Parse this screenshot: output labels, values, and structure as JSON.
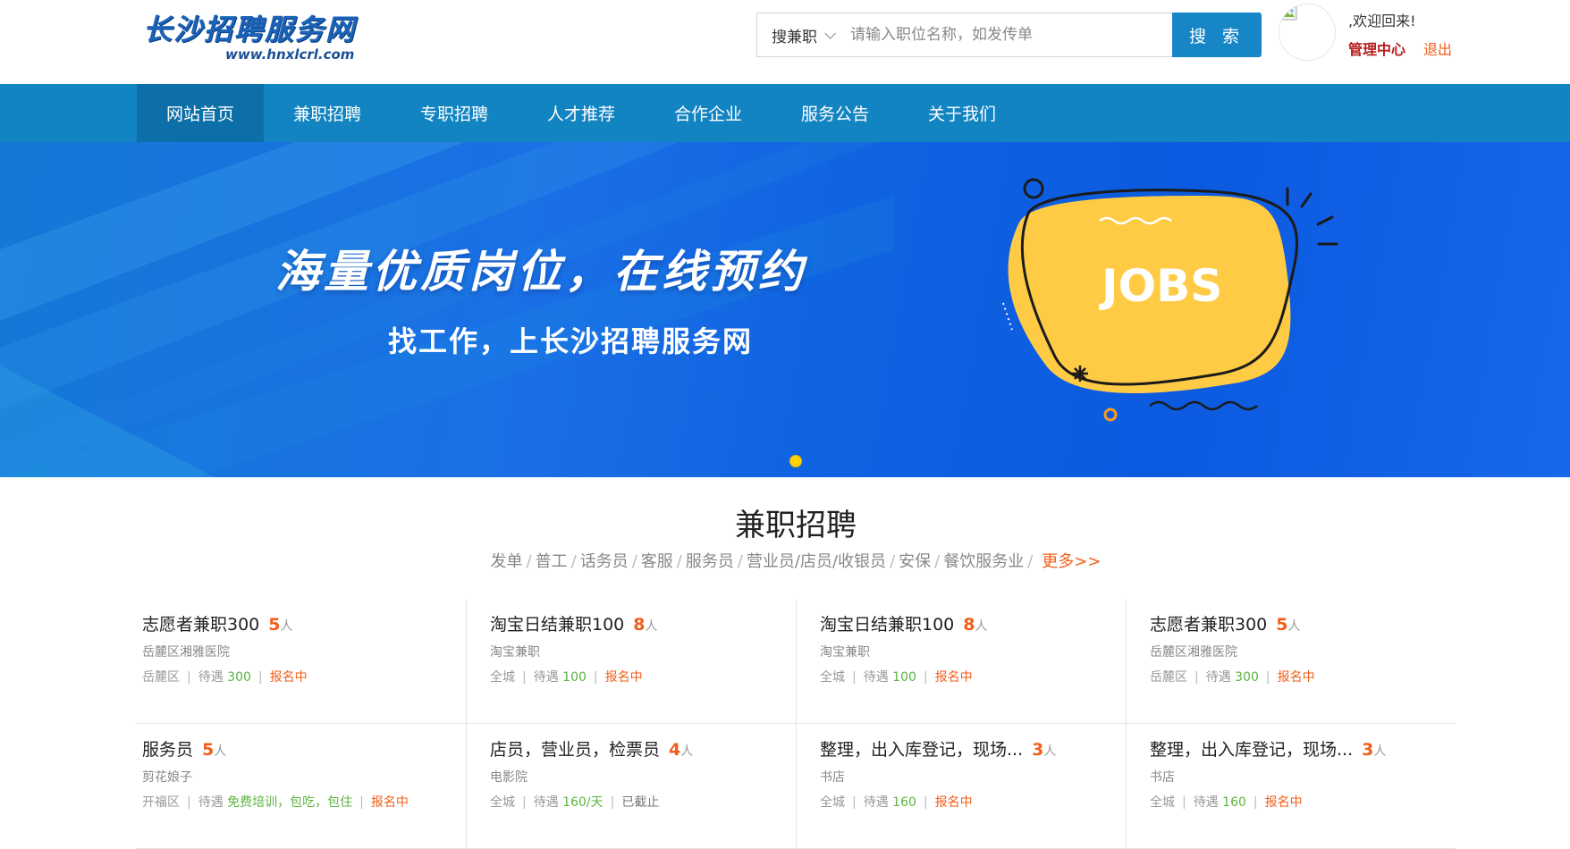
{
  "header": {
    "logo_main": "长沙招聘服务网",
    "logo_sub": "www.hnxlcrl.com",
    "search_type": "搜兼职",
    "search_placeholder": "请输入职位名称，如发传单",
    "search_button": "搜 索",
    "welcome": ",欢迎回来!",
    "admin_link": "管理中心",
    "logout_link": "退出"
  },
  "nav": {
    "items": [
      "网站首页",
      "兼职招聘",
      "专职招聘",
      "人才推荐",
      "合作企业",
      "服务公告",
      "关于我们"
    ],
    "active_index": 0
  },
  "banner": {
    "title": "海量优质岗位，在线预约",
    "subtitle": "找工作，上长沙招聘服务网",
    "graphic_text": "JOBS"
  },
  "section": {
    "title": "兼职招聘",
    "tags": [
      "发单",
      "普工",
      "话务员",
      "客服",
      "服务员",
      "营业员/店员/收银员",
      "安保",
      "餐饮服务业"
    ],
    "more": "更多>>"
  },
  "labels": {
    "pay_prefix": "待遇",
    "unit": "人"
  },
  "jobs": [
    {
      "title": "志愿者兼职300",
      "count": "5",
      "company": "岳麓区湘雅医院",
      "area": "岳麓区",
      "pay": "300",
      "status": "报名中",
      "status_type": "open"
    },
    {
      "title": "淘宝日结兼职100",
      "count": "8",
      "company": "淘宝兼职",
      "area": "全城",
      "pay": "100",
      "status": "报名中",
      "status_type": "open"
    },
    {
      "title": "淘宝日结兼职100",
      "count": "8",
      "company": "淘宝兼职",
      "area": "全城",
      "pay": "100",
      "status": "报名中",
      "status_type": "open"
    },
    {
      "title": "志愿者兼职300",
      "count": "5",
      "company": "岳麓区湘雅医院",
      "area": "岳麓区",
      "pay": "300",
      "status": "报名中",
      "status_type": "open"
    },
    {
      "title": "服务员",
      "count": "5",
      "company": "剪花娘子",
      "area": "开福区",
      "pay": "免费培训，包吃，包住",
      "status": "报名中",
      "status_type": "open"
    },
    {
      "title": "店员，营业员，检票员",
      "count": "4",
      "company": "电影院",
      "area": "全城",
      "pay": "160/天",
      "status": "已截止",
      "status_type": "closed"
    },
    {
      "title": "整理，出入库登记，现场...",
      "count": "3",
      "company": "书店",
      "area": "全城",
      "pay": "160",
      "status": "报名中",
      "status_type": "open"
    },
    {
      "title": "整理，出入库登记，现场...",
      "count": "3",
      "company": "书店",
      "area": "全城",
      "pay": "160",
      "status": "报名中",
      "status_type": "open"
    }
  ],
  "colors": {
    "brand_blue": "#1384c2",
    "accent_orange": "#f25e1a",
    "pay_green": "#5db342"
  }
}
